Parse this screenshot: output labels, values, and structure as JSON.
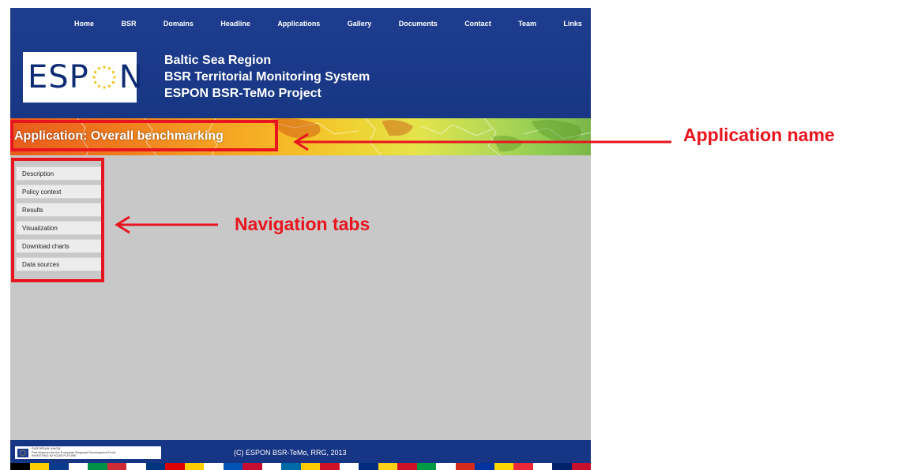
{
  "topnav": {
    "items": [
      "Home",
      "BSR",
      "Domains",
      "Headline",
      "Applications",
      "Gallery",
      "Documents",
      "Contact",
      "Team",
      "Links"
    ]
  },
  "logo": {
    "left": "ESP",
    "right": "N"
  },
  "site_title": {
    "line1": "Baltic Sea Region",
    "line2": "BSR Territorial Monitoring System",
    "line3": "ESPON BSR-TeMo Project"
  },
  "banner": {
    "app_name": "Application: Overall benchmarking"
  },
  "sidenav": {
    "items": [
      "Description",
      "Policy context",
      "Results",
      "Visualization",
      "Download charts",
      "Data sources"
    ]
  },
  "footer": {
    "eu_line1": "EUROPEAN UNION",
    "eu_line2": "Part-financed by the European Regional Development Fund",
    "eu_line3": "INVESTING IN YOUR FUTURE",
    "copyright": "(C) ESPON BSR-TeMo, RRG, 2013"
  },
  "annotations": {
    "app_name_label": "Application name",
    "nav_tabs_label": "Navigation tabs",
    "color": "#e8141e"
  },
  "colors": {
    "header_blue": "#1f3d8f",
    "content_gray": "#c8c8c8",
    "footer_blue": "#163584"
  }
}
